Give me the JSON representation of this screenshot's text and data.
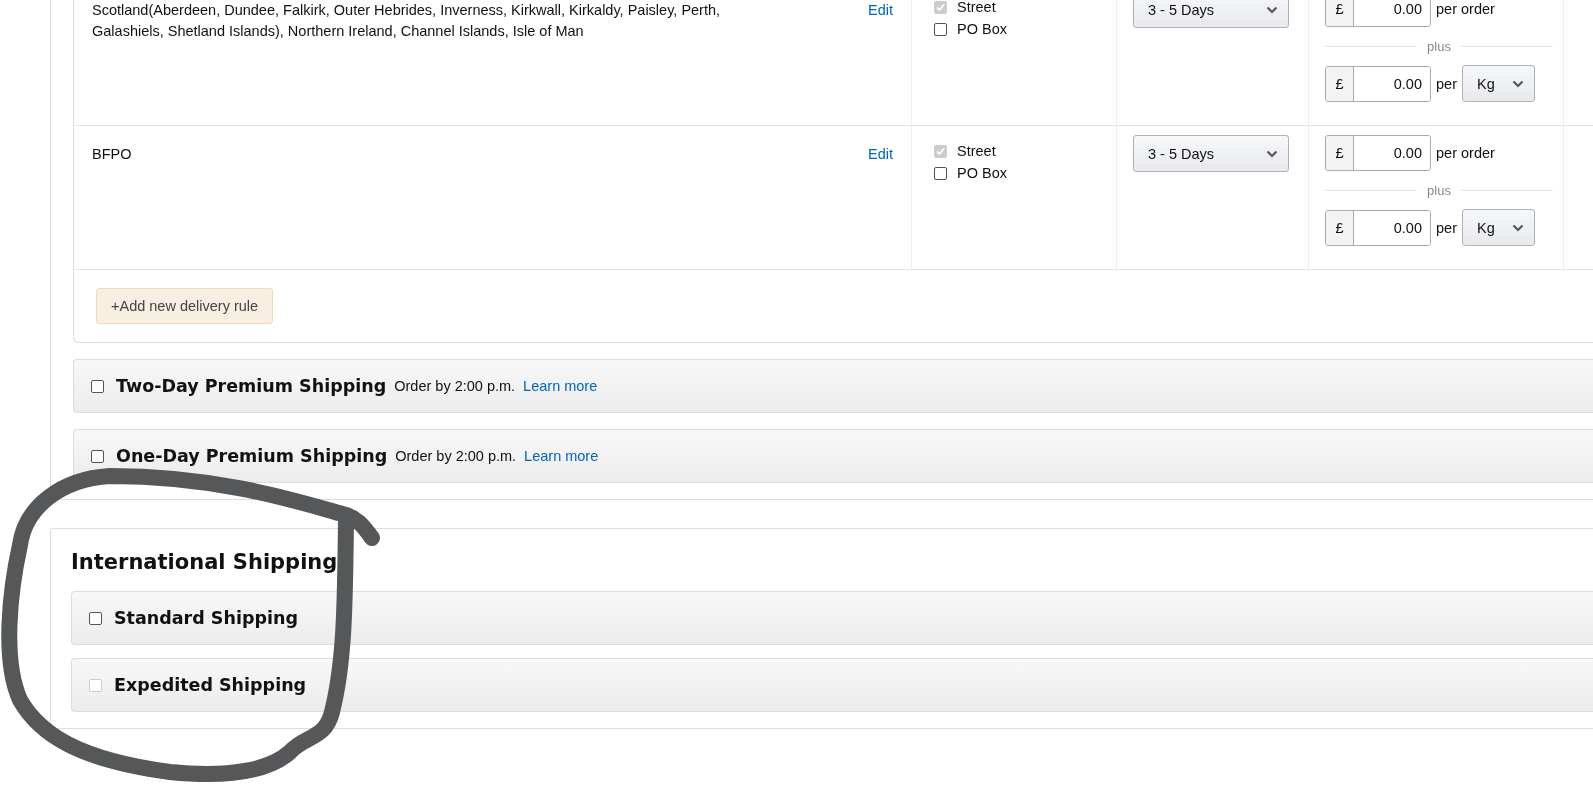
{
  "rules_table": {
    "rows": [
      {
        "region": "Scotland(Aberdeen, Dundee, Falkirk, Outer Hebrides, Inverness, Kirkwall, Kirkaldy, Paisley, Perth, Galashiels, Shetland Islands), Northern Ireland, Channel Islands, Isle of Man",
        "edit": "Edit",
        "address_types": [
          {
            "label": "Street",
            "checked": true,
            "disabled": true
          },
          {
            "label": "PO Box",
            "checked": false,
            "disabled": false
          }
        ],
        "transit_time": "3 - 5 Days",
        "per_order": {
          "currency": "£",
          "value": "0.00",
          "unit": "per order"
        },
        "separator": "plus",
        "per_weight": {
          "currency": "£",
          "value": "0.00",
          "per": "per",
          "unit": "Kg"
        }
      },
      {
        "region": "BFPO",
        "edit": "Edit",
        "address_types": [
          {
            "label": "Street",
            "checked": true,
            "disabled": true
          },
          {
            "label": "PO Box",
            "checked": false,
            "disabled": false
          }
        ],
        "transit_time": "3 - 5 Days",
        "per_order": {
          "currency": "£",
          "value": "0.00",
          "unit": "per order"
        },
        "separator": "plus",
        "per_weight": {
          "currency": "£",
          "value": "0.00",
          "per": "per",
          "unit": "Kg"
        }
      }
    ]
  },
  "add_rule_button": "+Add new delivery rule",
  "domestic_options": [
    {
      "title": "Two-Day Premium Shipping",
      "note": "Order by 2:00 p.m.",
      "link": "Learn more",
      "checked": false,
      "disabled": false
    },
    {
      "title": "One-Day Premium Shipping",
      "note": "Order by 2:00 p.m.",
      "link": "Learn more",
      "checked": false,
      "disabled": false
    }
  ],
  "international": {
    "title": "International Shipping",
    "options": [
      {
        "title": "Standard Shipping",
        "checked": false,
        "disabled": false
      },
      {
        "title": "Expedited Shipping",
        "checked": false,
        "disabled": true
      }
    ]
  }
}
